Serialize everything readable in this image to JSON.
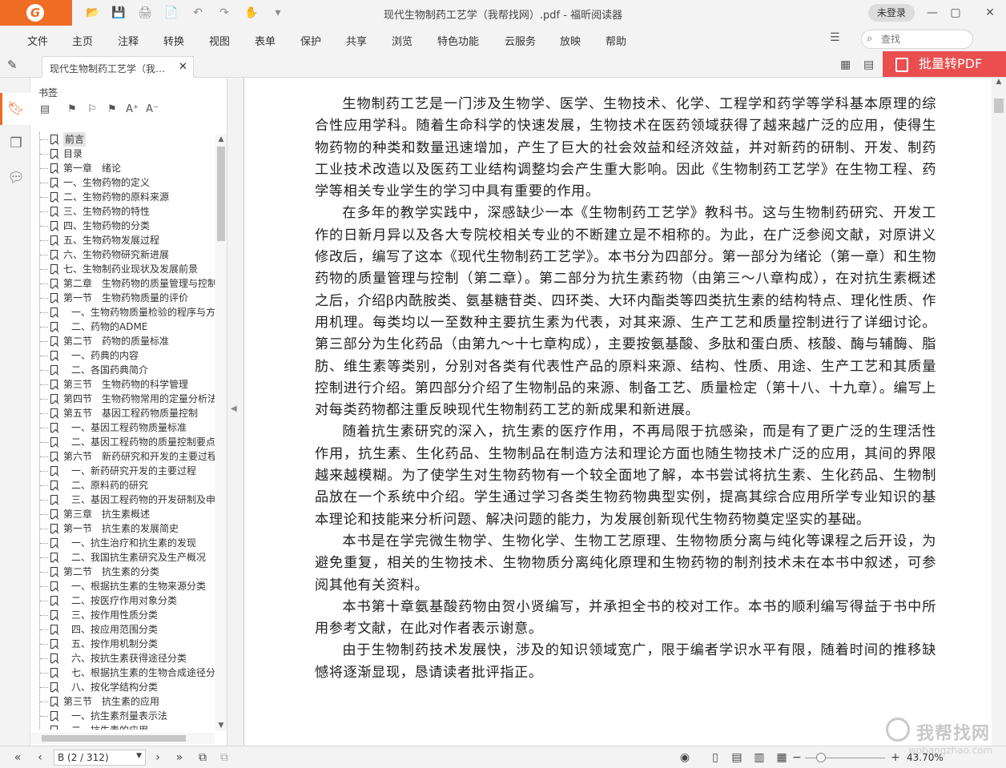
{
  "app": {
    "logo_char": "G",
    "window_title": "现代生物制药工艺学（我帮找网）.pdf - 福昕阅读器",
    "login_label": "未登录",
    "window_controls": [
      "—",
      "▢",
      "□",
      "✕"
    ],
    "quick_access": [
      "📂",
      "💾",
      "🖨",
      "📄",
      "↶",
      "↷",
      "✋",
      "▾"
    ],
    "accent_color": "#ef6c24"
  },
  "menu": [
    "文件",
    "主页",
    "注释",
    "转换",
    "视图",
    "表单",
    "保护",
    "共享",
    "浏览",
    "特色功能",
    "云服务",
    "放映",
    "帮助"
  ],
  "search": {
    "placeholder": "查找",
    "icon": "search-icon"
  },
  "tab": {
    "title": "现代生物制药工艺学（我…",
    "close": "✕"
  },
  "promo": {
    "label": "批量转PDF",
    "color": "#ea4e4e"
  },
  "bookmarks": {
    "title": "书签",
    "items": [
      {
        "label": "前言",
        "level": 0,
        "selected": true
      },
      {
        "label": "目录",
        "level": 0
      },
      {
        "label": "第一章　绪论",
        "level": 0
      },
      {
        "label": "一、生物药物的定义",
        "level": 0
      },
      {
        "label": "二、生物药物的原料来源",
        "level": 0
      },
      {
        "label": "三、生物药物的特性",
        "level": 0
      },
      {
        "label": "四、生物药物的分类",
        "level": 0
      },
      {
        "label": "五、生物药物发展过程",
        "level": 0
      },
      {
        "label": "六、生物药物研究新进展",
        "level": 0
      },
      {
        "label": "七、生物制药业现状及发展前景",
        "level": 0
      },
      {
        "label": "第二章　生物药物的质量管理与控制",
        "level": 0
      },
      {
        "label": "第一节　生物药物质量的评价",
        "level": 0
      },
      {
        "label": "一、生物药物质量检验的程序与方",
        "level": 1
      },
      {
        "label": "二、药物的ADME",
        "level": 1
      },
      {
        "label": "第二节　药物的质量标准",
        "level": 0
      },
      {
        "label": "一、药典的内容",
        "level": 1
      },
      {
        "label": "二、各国药典简介",
        "level": 1
      },
      {
        "label": "第三节　生物药物的科学管理",
        "level": 0
      },
      {
        "label": "第四节　生物药物常用的定量分析法",
        "level": 0
      },
      {
        "label": "第五节　基因工程药物质量控制",
        "level": 0
      },
      {
        "label": "一、基因工程药物质量标准",
        "level": 1
      },
      {
        "label": "二、基因工程药物的质量控制要点",
        "level": 1
      },
      {
        "label": "第六节　新药研究和开发的主要过程",
        "level": 0
      },
      {
        "label": "一、新药研究开发的主要过程",
        "level": 1
      },
      {
        "label": "二、原料药的研究",
        "level": 1
      },
      {
        "label": "三、基因工程药物的开发研制及申",
        "level": 1
      },
      {
        "label": "第三章　抗生素概述",
        "level": 0
      },
      {
        "label": "第一节　抗生素的发展简史",
        "level": 0
      },
      {
        "label": "一、抗生治疗和抗生素的发现",
        "level": 1
      },
      {
        "label": "二、我国抗生素研究及生产概况",
        "level": 1
      },
      {
        "label": "第二节　抗生素的分类",
        "level": 0
      },
      {
        "label": "一、根据抗生素的生物来源分类",
        "level": 1
      },
      {
        "label": "二、按医疗作用对象分类",
        "level": 1
      },
      {
        "label": "三、按作用性质分类",
        "level": 1
      },
      {
        "label": "四、按应用范围分类",
        "level": 1
      },
      {
        "label": "五、按作用机制分类",
        "level": 1
      },
      {
        "label": "六、按抗生素获得途径分类",
        "level": 1
      },
      {
        "label": "七、根据抗生素的生物合成途径分",
        "level": 1
      },
      {
        "label": "八、按化学结构分类",
        "level": 1
      },
      {
        "label": "第三节　抗生素的应用",
        "level": 0
      },
      {
        "label": "一、抗生素剂量表示法",
        "level": 1
      },
      {
        "label": "二、抗生素的应用",
        "level": 1
      }
    ]
  },
  "document": {
    "paragraphs": [
      "生物制药工艺是一门涉及生物学、医学、生物技术、化学、工程学和药学等学科基本原理的综合性应用学科。随着生命科学的快速发展，生物技术在医药领域获得了越来越广泛的应用，使得生物药物的种类和数量迅速增加，产生了巨大的社会效益和经济效益，并对新药的研制、开发、制药工业技术改造以及医药工业结构调整均会产生重大影响。因此《生物制药工艺学》在生物工程、药学等相关专业学生的学习中具有重要的作用。",
      "在多年的教学实践中，深感缺少一本《生物制药工艺学》教科书。这与生物制药研究、开发工作的日新月异以及各大专院校相关专业的不断建立是不相称的。为此，在广泛参阅文献，对原讲义修改后，编写了这本《现代生物制药工艺学》。本书分为四部分。第一部分为绪论（第一章）和生物药物的质量管理与控制（第二章）。第二部分为抗生素药物（由第三～八章构成），在对抗生素概述之后，介绍β内酰胺类、氨基糖苷类、四环类、大环内酯类等四类抗生素的结构特点、理化性质、作用机理。每类均以一至数种主要抗生素为代表，对其来源、生产工艺和质量控制进行了详细讨论。第三部分为生化药品（由第九～十七章构成），主要按氨基酸、多肽和蛋白质、核酸、酶与辅酶、脂肪、维生素等类别，分别对各类有代表性产品的原料来源、结构、性质、用途、生产工艺和其质量控制进行介绍。第四部分介绍了生物制品的来源、制备工艺、质量检定（第十八、十九章）。编写上对每类药物都注重反映现代生物制药工艺的新成果和新进展。",
      "随着抗生素研究的深入，抗生素的医疗作用，不再局限于抗感染，而是有了更广泛的生理活性作用，抗生素、生化药品、生物制品在制造方法和理论方面也随生物技术广泛的应用，其间的界限越来越模糊。为了使学生对生物药物有一个较全面地了解，本书尝试将抗生素、生化药品、生物制品放在一个系统中介绍。学生通过学习各类生物药物典型实例，提高其综合应用所学专业知识的基本理论和技能来分析问题、解决问题的能力，为发展创新现代生物药物奠定坚实的基础。",
      "本书是在学完微生物学、生物化学、生物工艺原理、生物物质分离与纯化等课程之后开设，为避免重复，相关的生物技术、生物物质分离纯化原理和生物药物的制剂技术未在本书中叙述，可参阅其他有关资料。",
      "本书第十章氨基酸药物由贺小贤编写，并承担全书的校对工作。本书的顺利编写得益于书中所用参考文献，在此对作者表示谢意。",
      "由于生物制药技术发展快，涉及的知识领域宽广，限于编者学识水平有限，随着时间的推移缺憾将逐渐显现，恳请读者批评指正。"
    ]
  },
  "status": {
    "page_field": "B (2 / 312)",
    "zoom": "43.70%",
    "zoom_level": 0.2
  },
  "watermark": {
    "text": "我帮找网",
    "url": "wobangzhao.com"
  }
}
